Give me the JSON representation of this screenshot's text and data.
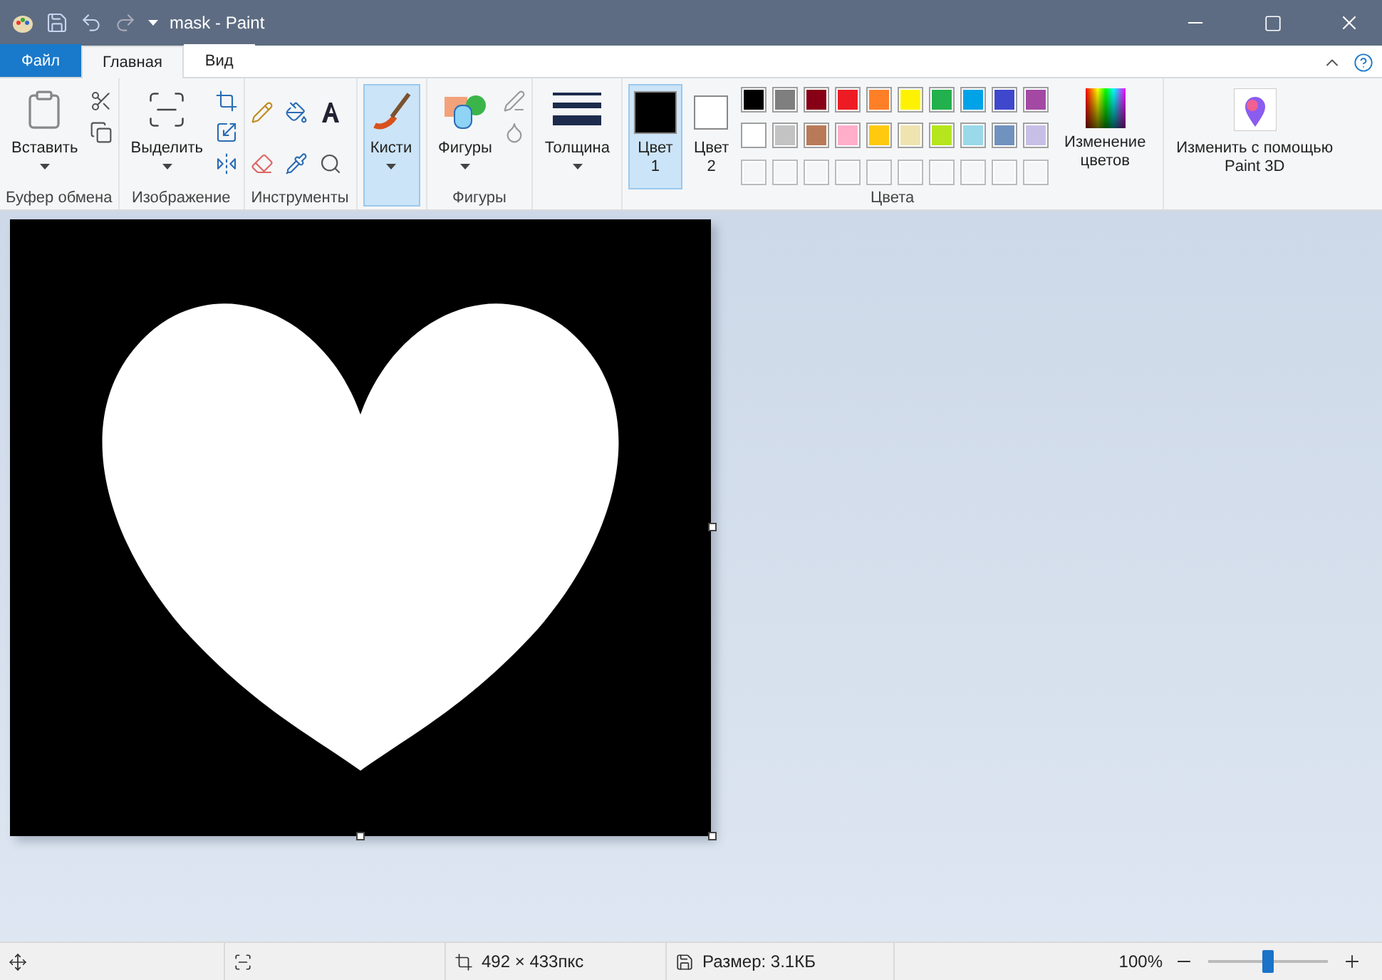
{
  "window": {
    "title": "mask - Paint"
  },
  "tabs": [
    {
      "label": "Файл",
      "kind": "file",
      "selected": false
    },
    {
      "label": "Главная",
      "kind": "tab",
      "selected": true
    },
    {
      "label": "Вид",
      "kind": "tab",
      "selected": false
    }
  ],
  "ribbon": {
    "clipboard": {
      "label": "Буфер обмена",
      "paste": "Вставить"
    },
    "image": {
      "label": "Изображение",
      "select": "Выделить"
    },
    "tools": {
      "label": "Инструменты"
    },
    "brushes": {
      "label": "Кисти",
      "selected": true
    },
    "shapes": {
      "label": "Фигуры",
      "button": "Фигуры"
    },
    "size": {
      "label": "Толщина"
    },
    "colors": {
      "label": "Цвета",
      "color1": {
        "label": "Цвет",
        "number": "1",
        "color": "#000000",
        "selected": true
      },
      "color2": {
        "label": "Цвет",
        "number": "2",
        "color": "#ffffff",
        "selected": false
      },
      "palette": [
        {
          "color": "#000000"
        },
        {
          "color": "#7f7f7f"
        },
        {
          "color": "#880015"
        },
        {
          "color": "#ed1c24"
        },
        {
          "color": "#ff7f27"
        },
        {
          "color": "#fff200"
        },
        {
          "color": "#22b14c"
        },
        {
          "color": "#00a2e8"
        },
        {
          "color": "#3f48cc"
        },
        {
          "color": "#a349a4"
        },
        {
          "color": "#ffffff"
        },
        {
          "color": "#c3c3c3"
        },
        {
          "color": "#b97a57"
        },
        {
          "color": "#ffaec9"
        },
        {
          "color": "#ffc90e"
        },
        {
          "color": "#efe4b0"
        },
        {
          "color": "#b5e61d"
        },
        {
          "color": "#99d9ea"
        },
        {
          "color": "#7092be"
        },
        {
          "color": "#c8bfe7"
        },
        {
          "kind": "empty"
        },
        {
          "kind": "empty"
        },
        {
          "kind": "empty"
        },
        {
          "kind": "empty"
        },
        {
          "kind": "empty"
        },
        {
          "kind": "empty"
        },
        {
          "kind": "empty"
        },
        {
          "kind": "empty"
        },
        {
          "kind": "empty"
        },
        {
          "kind": "empty"
        }
      ],
      "edit_colors": "Изменение цветов"
    },
    "paint3d": {
      "label": "Изменить с помощью Paint 3D"
    }
  },
  "status_bar": {
    "dimensions": "492 × 433пкс",
    "size": "Размер: 3.1КБ",
    "zoom": "100%",
    "zoom_slider": {
      "level": 0.5
    }
  }
}
